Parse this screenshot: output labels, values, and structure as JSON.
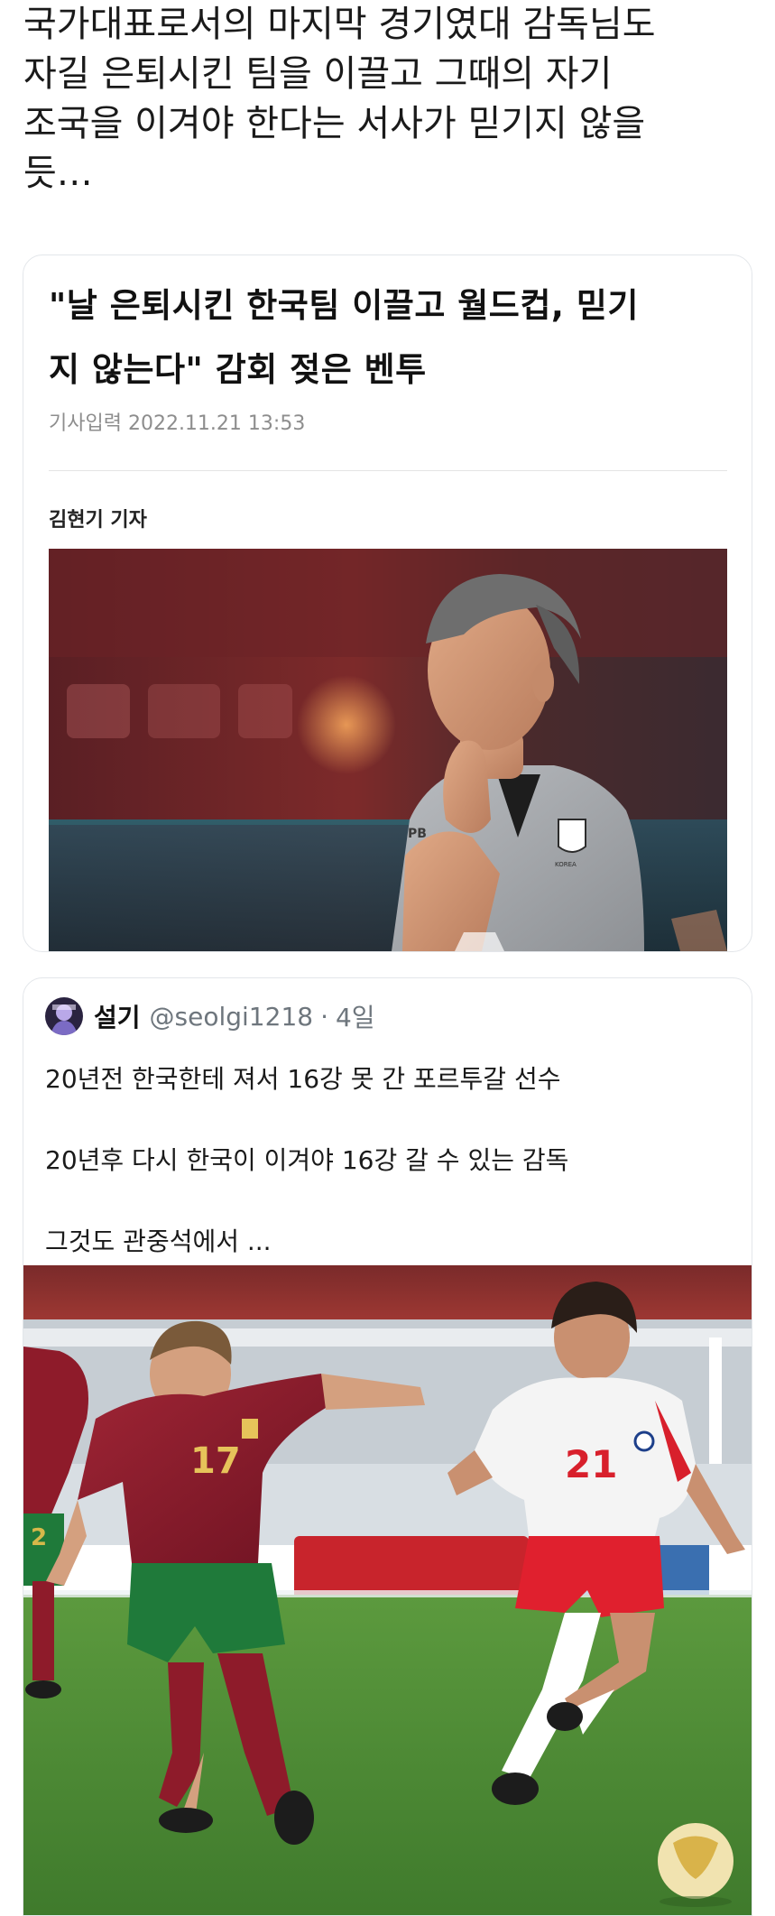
{
  "intro": {
    "lines": [
      "국가대표로서의 마지막 경기였대 감독님도",
      "자길 은퇴시킨 팀을 이끌고 그때의 자기",
      "조국을 이겨야 한다는 서사가 믿기지 않을",
      "듯…"
    ]
  },
  "article": {
    "title_lines": [
      "\"날 은퇴시킨 한국팀 이끌고 월드컵, 믿기",
      "지 않는다\" 감회 젖은 벤투"
    ],
    "date": "기사입력 2022.11.21 13:53",
    "author": "김현기 기자",
    "photo": {
      "shirt_text": "PB",
      "badge_text": "KOREA"
    }
  },
  "tweet": {
    "name": "설기",
    "handle": "@seolgi1218",
    "separator": "·",
    "time": "4일",
    "lines": [
      "20년전 한국한테 져서 16강 못 간 포르투갈 선수",
      "20년후 다시 한국이 이겨야 16강 갈 수 있는 감독",
      "그것도 관중석에서 ..."
    ],
    "photo": {
      "player_left_number": "17",
      "player_right_number": "21",
      "player_back_number": "2"
    }
  },
  "colors": {
    "text": "#1a1a1a",
    "muted": "#8d8d8d",
    "handle": "#6e767d",
    "card_border": "#e3e6ea",
    "portugal_shirt": "#8e1b2a",
    "portugal_shorts": "#1f7a3a",
    "korea_shorts": "#e0202e",
    "pitch": "#4d8a35"
  }
}
